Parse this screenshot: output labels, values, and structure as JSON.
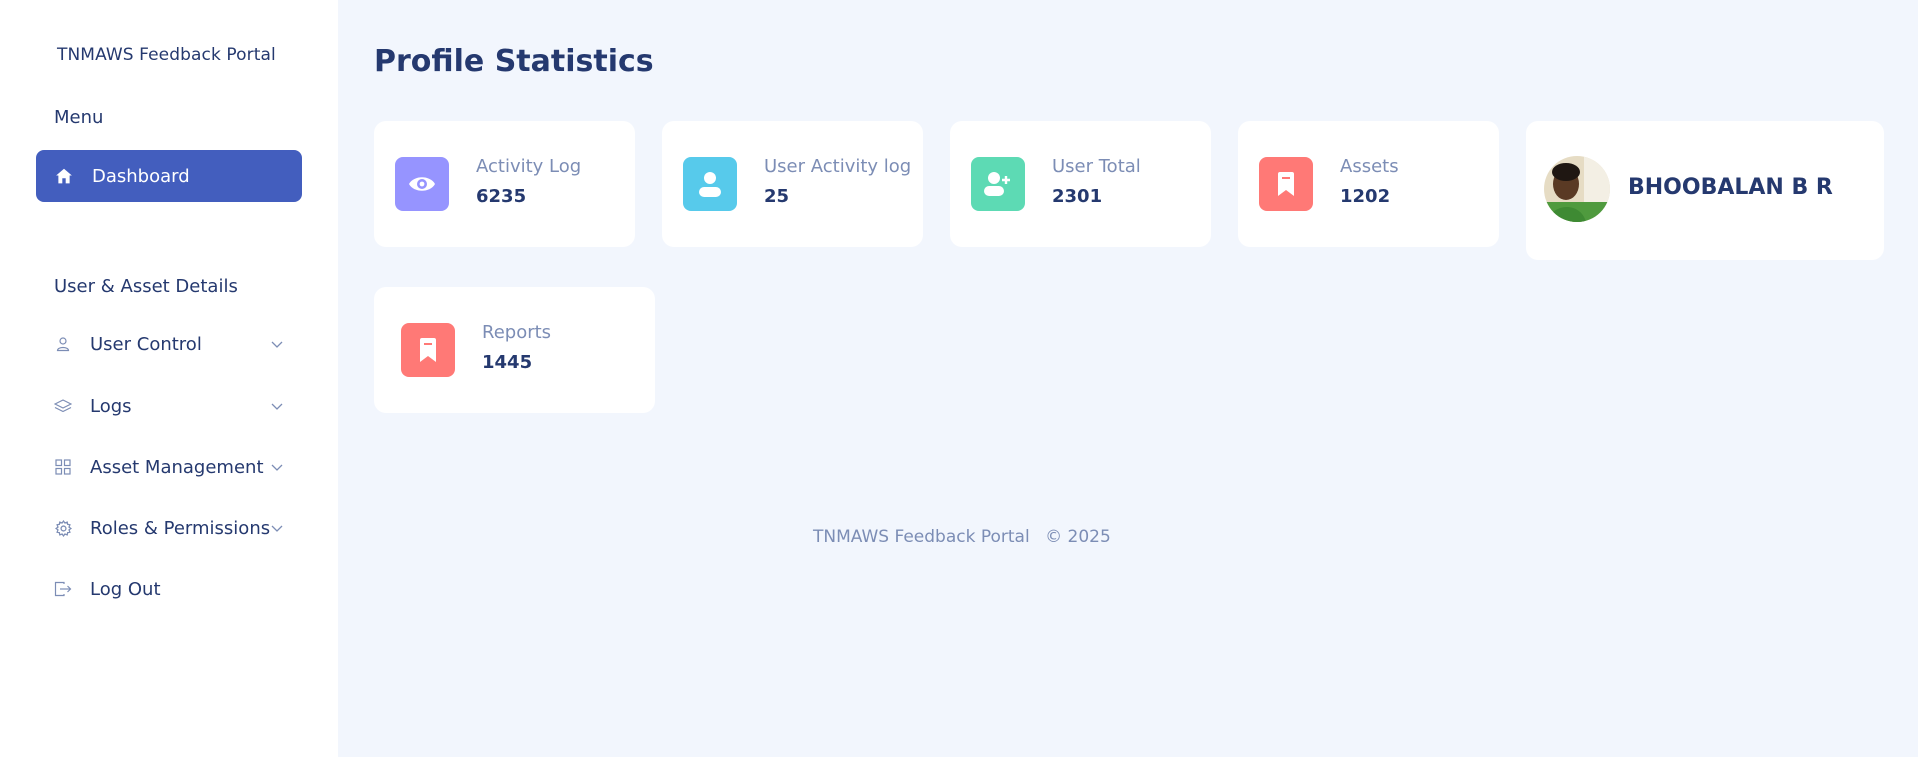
{
  "sidebar": {
    "brand": "TNMAWS Feedback Portal",
    "menu_title": "Menu",
    "dashboard_label": "Dashboard",
    "section_title": "User & Asset Details",
    "items": [
      {
        "label": "User Control",
        "icon": "person-icon",
        "has_chevron": true
      },
      {
        "label": "Logs",
        "icon": "layers-icon",
        "has_chevron": true
      },
      {
        "label": "Asset Management",
        "icon": "grid-icon",
        "has_chevron": true
      },
      {
        "label": "Roles & Permissions",
        "icon": "gear-icon",
        "has_chevron": true
      },
      {
        "label": "Log Out",
        "icon": "logout-icon",
        "has_chevron": false
      }
    ]
  },
  "main": {
    "title": "Profile Statistics",
    "stats": [
      {
        "label": "Activity Log",
        "value": "6235",
        "icon": "eye-icon",
        "color": "#9694ff"
      },
      {
        "label": "User Activity log",
        "value": "25",
        "icon": "person-icon",
        "color": "#57caeb"
      },
      {
        "label": "User Total",
        "value": "2301",
        "icon": "person-add-icon",
        "color": "#5ddab4"
      },
      {
        "label": "Assets",
        "value": "1202",
        "icon": "bookmark-icon",
        "color": "#ff7976"
      },
      {
        "label": "Reports",
        "value": "1445",
        "icon": "bookmark-icon",
        "color": "#ff7976"
      }
    ],
    "profile": {
      "name": "BHOOBALAN B R"
    }
  },
  "footer": {
    "text": "TNMAWS Feedback Portal",
    "copyright": "© 2025"
  },
  "colors": {
    "accent": "#435ebe",
    "background": "#f2f6fd",
    "text": "#25396f",
    "muted": "#7c8db5"
  }
}
